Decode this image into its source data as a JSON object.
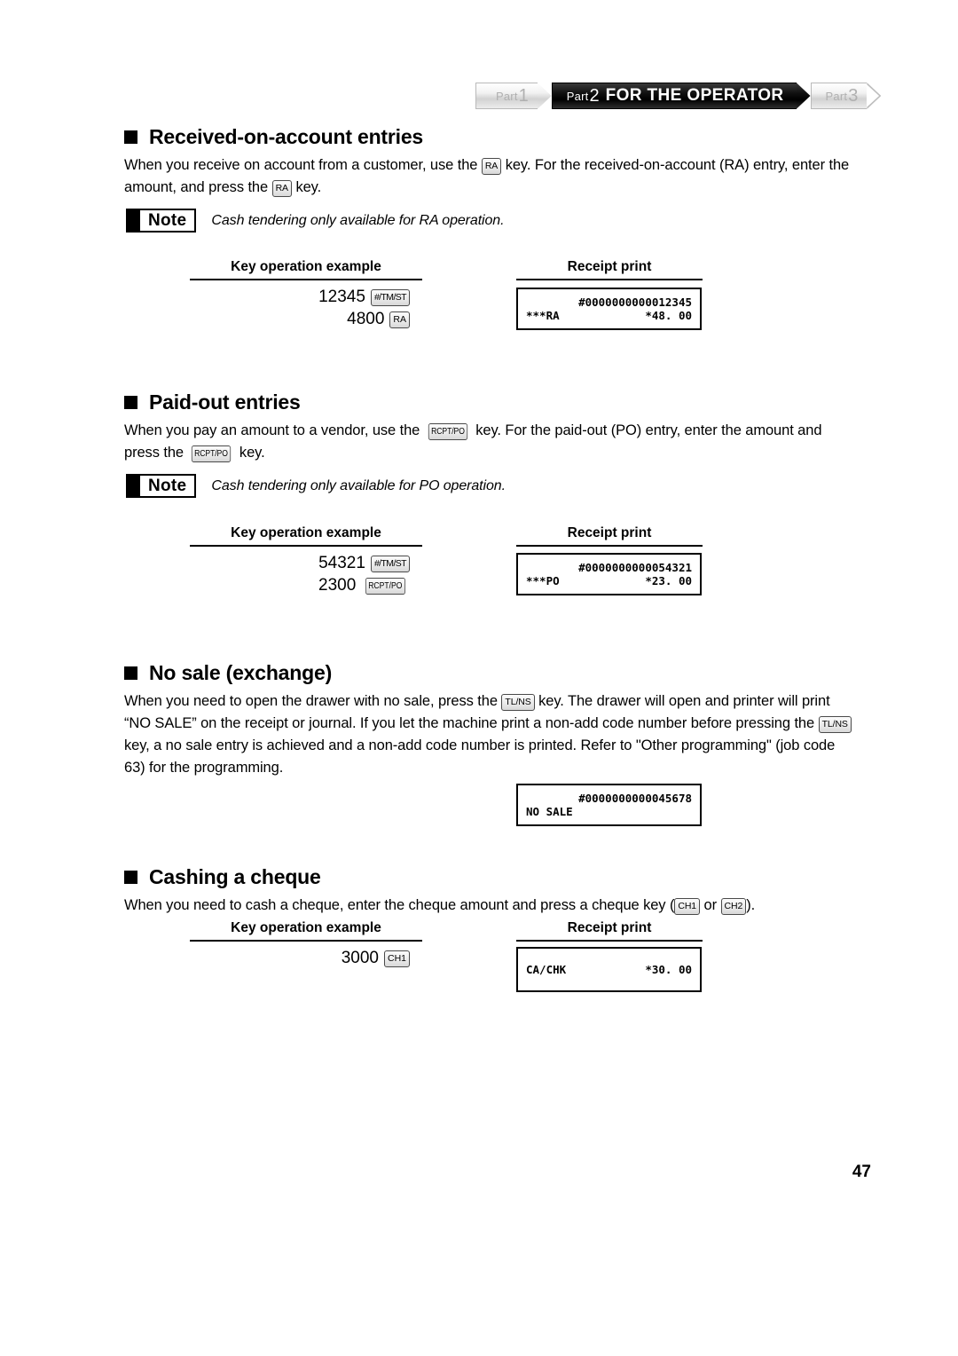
{
  "header": {
    "tabs": [
      {
        "part_word": "Part",
        "part_num": "1",
        "title": "",
        "active": false
      },
      {
        "part_word": "Part",
        "part_num": "2",
        "title": "FOR THE OPERATOR",
        "active": true
      },
      {
        "part_word": "Part",
        "part_num": "3",
        "title": "",
        "active": false
      }
    ]
  },
  "labels": {
    "key_operation_example": "Key operation example",
    "receipt_print": "Receipt print",
    "note": "Note"
  },
  "keys": {
    "ra": "RA",
    "tm_st": "#/TM/ST",
    "rcpt_po": "RCPT/PO",
    "tl_ns": "TL/NS",
    "ch1": "CH1",
    "ch2": "CH2"
  },
  "sections": [
    {
      "id": "received-on-account",
      "heading": "Received-on-account entries",
      "paragraph_parts": [
        "When you receive on account from a customer, use the ",
        "RA",
        " key.  For the received-on-account (RA) entry, enter the amount, and press the ",
        "RA",
        " key."
      ],
      "note": "Cash tendering only available for RA operation.",
      "key_ops": [
        {
          "amount": "12345",
          "key": "#/TM/ST"
        },
        {
          "amount": "4800",
          "key": "RA"
        }
      ],
      "receipt": {
        "lines": [
          {
            "left": "",
            "right": "#0000000000012345"
          },
          {
            "left": "***RA",
            "right": "*48. 00"
          }
        ]
      }
    },
    {
      "id": "paid-out",
      "heading": "Paid-out entries",
      "paragraph_parts": [
        "When you pay an amount to a vendor, use the ",
        "RCPT/PO",
        " key.  For the paid-out (PO) entry, enter the amount and press the ",
        "RCPT/PO",
        " key."
      ],
      "note": "Cash tendering only available for PO operation.",
      "key_ops": [
        {
          "amount": "54321",
          "key": "#/TM/ST"
        },
        {
          "amount": "2300",
          "key": "RCPT/PO"
        }
      ],
      "receipt": {
        "lines": [
          {
            "left": "",
            "right": "#0000000000054321"
          },
          {
            "left": "***PO",
            "right": "*23. 00"
          }
        ]
      }
    },
    {
      "id": "no-sale",
      "heading": "No sale (exchange)",
      "paragraph_parts": [
        "When you need to open the drawer with no sale, press the ",
        "TL/NS",
        " key.  The drawer will open and printer will print “NO SALE” on the receipt or journal.  If you let the machine print a non-add code number before pressing the ",
        "TL/NS",
        " key, a no sale entry is achieved and a non-add code number is printed.  Refer to \"Other programming\" (job code 63) for the programming."
      ],
      "receipt": {
        "lines": [
          {
            "left": "",
            "right": "#0000000000045678"
          },
          {
            "left": "NO SALE",
            "right": ""
          }
        ]
      }
    },
    {
      "id": "cashing-a-cheque",
      "heading": "Cashing a cheque",
      "paragraph_parts": [
        "When you need to cash a cheque, enter the cheque amount and press a cheque key (",
        "CH1",
        " or ",
        "CH2",
        ")."
      ],
      "key_ops": [
        {
          "amount": "3000",
          "key": "CH1"
        }
      ],
      "receipt": {
        "lines": [
          {
            "left": "CA/CHK",
            "right": "*30. 00"
          }
        ]
      }
    }
  ],
  "page_number": "47"
}
